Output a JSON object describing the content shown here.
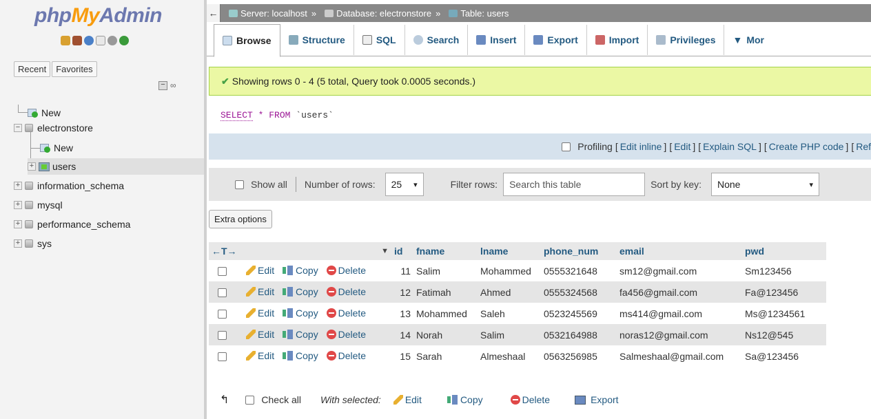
{
  "sidebar": {
    "logo": {
      "php": "php",
      "my": "My",
      "admin": "Admin"
    },
    "tabs": [
      "Recent",
      "Favorites"
    ],
    "tree": [
      {
        "label": "New",
        "type": "new",
        "level": 0
      },
      {
        "label": "electronstore",
        "type": "db",
        "level": 0,
        "expanded": true
      },
      {
        "label": "New",
        "type": "new",
        "level": 1
      },
      {
        "label": "users",
        "type": "table",
        "level": 1
      },
      {
        "label": "information_schema",
        "type": "db",
        "level": 0
      },
      {
        "label": "mysql",
        "type": "db",
        "level": 0
      },
      {
        "label": "performance_schema",
        "type": "db",
        "level": 0
      },
      {
        "label": "sys",
        "type": "db",
        "level": 0
      }
    ]
  },
  "breadcrumb": {
    "server": "Server: localhost",
    "database": "Database: electronstore",
    "table": "Table: users",
    "separator": "»"
  },
  "menu": {
    "browse": "Browse",
    "structure": "Structure",
    "sql": "SQL",
    "search": "Search",
    "insert": "Insert",
    "export": "Export",
    "import": "Import",
    "privileges": "Privileges",
    "more": "Mor"
  },
  "success": {
    "message": "Showing rows 0 - 4 (5 total, Query took 0.0005 seconds.)"
  },
  "query": {
    "select": "SELECT",
    "star": "*",
    "from": "FROM",
    "table": "`users`"
  },
  "profiling": {
    "label": "Profiling",
    "links": [
      "Edit inline",
      "Edit",
      "Explain SQL",
      "Create PHP code",
      "Ref"
    ]
  },
  "navigation": {
    "show_all": "Show all",
    "rows_label": "Number of rows:",
    "rows_value": "25",
    "filter_label": "Filter rows:",
    "filter_placeholder": "Search this table",
    "sort_label": "Sort by key:",
    "sort_value": "None"
  },
  "extra_options": "Extra options",
  "table": {
    "columns": [
      "id",
      "fname",
      "lname",
      "phone_num",
      "email",
      "pwd"
    ],
    "actions": {
      "edit": "Edit",
      "copy": "Copy",
      "delete": "Delete"
    },
    "rows": [
      {
        "id": "11",
        "fname": "Salim",
        "lname": "Mohammed",
        "phone_num": "0555321648",
        "email": "sm12@gmail.com",
        "pwd": "Sm123456"
      },
      {
        "id": "12",
        "fname": "Fatimah",
        "lname": "Ahmed",
        "phone_num": "0555324568",
        "email": "fa456@gmail.com",
        "pwd": "Fa@123456"
      },
      {
        "id": "13",
        "fname": "Mohammed",
        "lname": "Saleh",
        "phone_num": "0523245569",
        "email": "ms414@gmail.com",
        "pwd": "Ms@1234561"
      },
      {
        "id": "14",
        "fname": "Norah",
        "lname": "Salim",
        "phone_num": "0532164988",
        "email": "noras12@gmail.com",
        "pwd": "Ns12@545"
      },
      {
        "id": "15",
        "fname": "Sarah",
        "lname": "Almeshaal",
        "phone_num": "0563256985",
        "email": "Salmeshaal@gmail.com",
        "pwd": "Sa@123456"
      }
    ]
  },
  "bottom": {
    "check_all": "Check all",
    "with_selected": "With selected:",
    "edit": "Edit",
    "copy": "Copy",
    "delete": "Delete",
    "export": "Export"
  },
  "colors": {
    "link": "#235a81",
    "success_bg": "#ebf8a4",
    "nav_bg": "#e5e5e5",
    "logo_blue": "#6c78af",
    "logo_orange": "#f89c0e"
  }
}
